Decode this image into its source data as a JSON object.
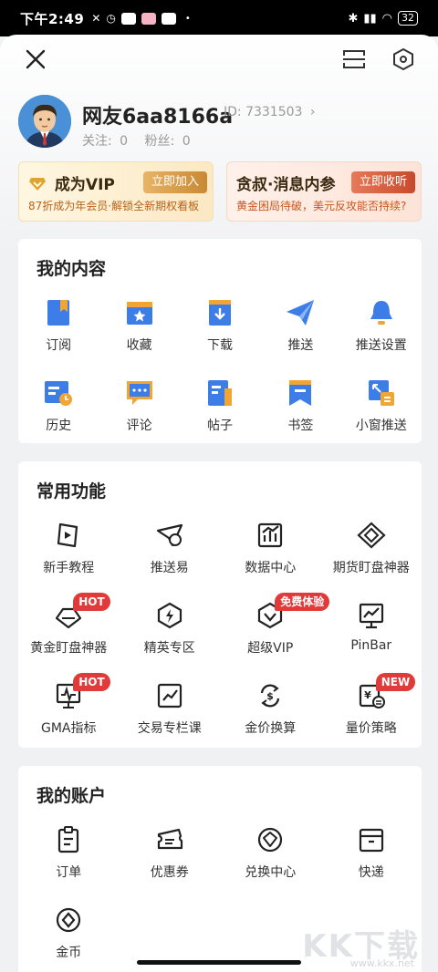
{
  "status_bar": {
    "time": "下午2:49",
    "battery": "32"
  },
  "profile": {
    "nickname": "网友6aa8166a",
    "id_label": "ID: 7331503",
    "following_label": "关注:",
    "following_count": "0",
    "fans_label": "粉丝:",
    "fans_count": "0"
  },
  "promos": {
    "vip": {
      "title": "成为VIP",
      "cta": "立即加入",
      "subtitle": "87折成为年会员·解锁全新期权看板"
    },
    "talk": {
      "title": "贪叔·消息内参",
      "cta": "立即收听",
      "subtitle": "黄金困局待破，美元反攻能否持续?"
    }
  },
  "my_content": {
    "title": "我的内容",
    "items": [
      {
        "label": "订阅",
        "icon": "subscribe-icon"
      },
      {
        "label": "收藏",
        "icon": "favorite-icon"
      },
      {
        "label": "下载",
        "icon": "download-icon"
      },
      {
        "label": "推送",
        "icon": "push-icon"
      },
      {
        "label": "推送设置",
        "icon": "bell-icon"
      },
      {
        "label": "历史",
        "icon": "history-icon"
      },
      {
        "label": "评论",
        "icon": "comment-icon"
      },
      {
        "label": "帖子",
        "icon": "post-icon"
      },
      {
        "label": "书签",
        "icon": "bookmark-icon"
      },
      {
        "label": "小窗推送",
        "icon": "mini-window-icon"
      }
    ]
  },
  "common_functions": {
    "title": "常用功能",
    "items": [
      {
        "label": "新手教程",
        "icon": "tutorial-icon"
      },
      {
        "label": "推送易",
        "icon": "push-easy-icon"
      },
      {
        "label": "数据中心",
        "icon": "data-center-icon"
      },
      {
        "label": "期货盯盘神器",
        "icon": "futures-monitor-icon"
      },
      {
        "label": "黄金盯盘神器",
        "icon": "gold-monitor-icon",
        "badge": "HOT"
      },
      {
        "label": "精英专区",
        "icon": "elite-icon"
      },
      {
        "label": "超级VIP",
        "icon": "super-vip-icon",
        "badge": "免费体验"
      },
      {
        "label": "PinBar",
        "icon": "pinbar-icon"
      },
      {
        "label": "GMA指标",
        "icon": "gma-icon",
        "badge": "HOT"
      },
      {
        "label": "交易专栏课",
        "icon": "trading-course-icon"
      },
      {
        "label": "金价换算",
        "icon": "gold-price-convert-icon"
      },
      {
        "label": "量价策略",
        "icon": "volume-price-icon",
        "badge": "NEW"
      }
    ]
  },
  "my_account": {
    "title": "我的账户",
    "items": [
      {
        "label": "订单",
        "icon": "order-icon"
      },
      {
        "label": "优惠券",
        "icon": "coupon-icon"
      },
      {
        "label": "兑换中心",
        "icon": "exchange-icon"
      },
      {
        "label": "快递",
        "icon": "express-icon"
      },
      {
        "label": "金币",
        "icon": "coin-icon"
      }
    ]
  },
  "watermark": {
    "brand": "KK下载",
    "url": "www.kkx.net"
  },
  "colors": {
    "accent_blue": "#3d7de8",
    "accent_orange": "#f1a534",
    "hot_red": "#e03a3a"
  }
}
